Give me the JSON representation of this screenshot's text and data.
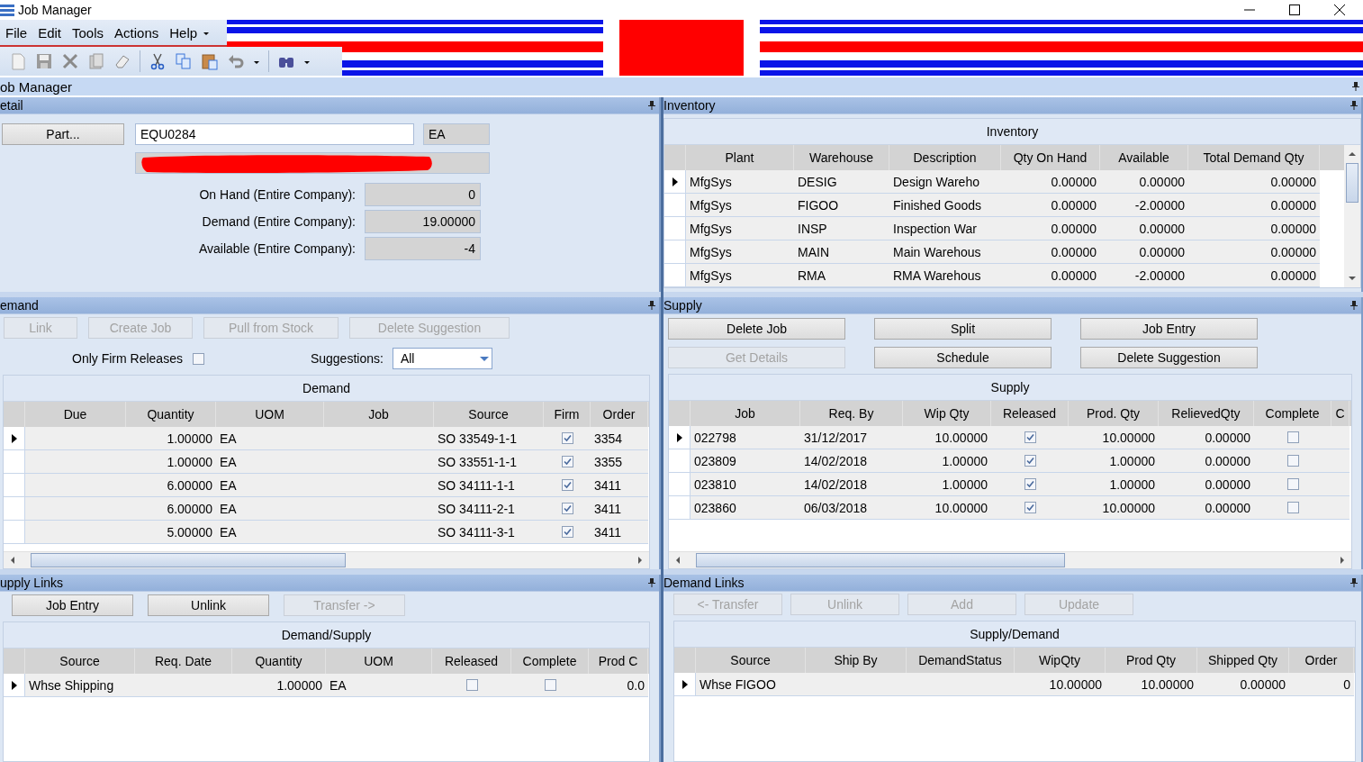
{
  "window": {
    "title": "Job Manager"
  },
  "menu": [
    "File",
    "Edit",
    "Tools",
    "Actions",
    "Help"
  ],
  "workspace": {
    "title": "ob Manager"
  },
  "detail": {
    "title": "etail",
    "part_button": "Part...",
    "part_number": "EQU0284",
    "uom": "EA",
    "description_redacted": true,
    "totals": [
      {
        "label": "On Hand (Entire Company):",
        "value": "0"
      },
      {
        "label": "Demand (Entire Company):",
        "value": "19.00000"
      },
      {
        "label": "Available (Entire Company):",
        "value": "-4"
      }
    ]
  },
  "inventory": {
    "title": "Inventory",
    "grid": {
      "caption": "Inventory",
      "columns": [
        {
          "label": "Plant",
          "kind": "text"
        },
        {
          "label": "Warehouse",
          "kind": "text"
        },
        {
          "label": "Description",
          "kind": "text"
        },
        {
          "label": "Qty On Hand",
          "kind": "number"
        },
        {
          "label": "Available",
          "kind": "number"
        },
        {
          "label": "Total Demand Qty",
          "kind": "number"
        }
      ],
      "rows": [
        {
          "selected": true,
          "cells": [
            "MfgSys",
            "DESIG",
            "Design Wareho",
            "0.00000",
            "0.00000",
            "0.00000"
          ]
        },
        {
          "selected": false,
          "cells": [
            "MfgSys",
            "FIGOO",
            "Finished Goods",
            "0.00000",
            "-2.00000",
            "0.00000"
          ]
        },
        {
          "selected": false,
          "cells": [
            "MfgSys",
            "INSP",
            "Inspection War",
            "0.00000",
            "0.00000",
            "0.00000"
          ]
        },
        {
          "selected": false,
          "cells": [
            "MfgSys",
            "MAIN",
            "Main Warehous",
            "0.00000",
            "0.00000",
            "0.00000"
          ]
        },
        {
          "selected": false,
          "cells": [
            "MfgSys",
            "RMA",
            "RMA Warehous",
            "0.00000",
            "-2.00000",
            "0.00000"
          ]
        }
      ]
    }
  },
  "demand": {
    "title": "emand",
    "buttons": [
      {
        "label": "Link",
        "disabled": true
      },
      {
        "label": "Create Job",
        "disabled": true
      },
      {
        "label": "Pull from Stock",
        "disabled": true
      },
      {
        "label": "Delete Suggestion",
        "disabled": true
      }
    ],
    "only_firm_releases": {
      "label": "Only Firm Releases",
      "checked": false
    },
    "suggestions": {
      "label": "Suggestions:",
      "value": "All"
    },
    "grid": {
      "caption": "Demand",
      "columns": [
        {
          "label": "Due",
          "kind": "text"
        },
        {
          "label": "Quantity",
          "kind": "number"
        },
        {
          "label": "UOM",
          "kind": "text"
        },
        {
          "label": "Job",
          "kind": "text"
        },
        {
          "label": "Source",
          "kind": "text"
        },
        {
          "label": "Firm",
          "kind": "check"
        },
        {
          "label": "Order",
          "kind": "text"
        }
      ],
      "rows": [
        {
          "selected": true,
          "cells": [
            null,
            "1.00000",
            "EA",
            null,
            "SO 33549-1-1",
            true,
            "3354"
          ]
        },
        {
          "selected": false,
          "cells": [
            null,
            "1.00000",
            "EA",
            null,
            "SO 33551-1-1",
            true,
            "3355"
          ]
        },
        {
          "selected": false,
          "cells": [
            null,
            "6.00000",
            "EA",
            null,
            "SO 34111-1-1",
            true,
            "3411"
          ]
        },
        {
          "selected": false,
          "cells": [
            null,
            "6.00000",
            "EA",
            null,
            "SO 34111-2-1",
            true,
            "3411"
          ]
        },
        {
          "selected": false,
          "cells": [
            null,
            "5.00000",
            "EA",
            null,
            "SO 34111-3-1",
            true,
            "3411"
          ]
        }
      ]
    }
  },
  "supply": {
    "title": "Supply",
    "buttons": [
      {
        "label": "Delete Job",
        "disabled": false
      },
      {
        "label": "Split",
        "disabled": false
      },
      {
        "label": "Job Entry",
        "disabled": false
      },
      {
        "label": "Get Details",
        "disabled": true
      },
      {
        "label": "Schedule",
        "disabled": false
      },
      {
        "label": "Delete Suggestion",
        "disabled": false
      }
    ],
    "grid": {
      "caption": "Supply",
      "columns": [
        {
          "label": "Job",
          "kind": "text"
        },
        {
          "label": "Req. By",
          "kind": "text"
        },
        {
          "label": "Wip Qty",
          "kind": "number"
        },
        {
          "label": "Released",
          "kind": "check"
        },
        {
          "label": "Prod. Qty",
          "kind": "number"
        },
        {
          "label": "RelievedQty",
          "kind": "number"
        },
        {
          "label": "Complete",
          "kind": "check"
        },
        {
          "label": "C",
          "kind": "text"
        }
      ],
      "rows": [
        {
          "selected": true,
          "cells": [
            "022798",
            "31/12/2017",
            "10.00000",
            true,
            "10.00000",
            "0.00000",
            false,
            null
          ]
        },
        {
          "selected": false,
          "cells": [
            "023809",
            "14/02/2018",
            "1.00000",
            true,
            "1.00000",
            "0.00000",
            false,
            null
          ]
        },
        {
          "selected": false,
          "cells": [
            "023810",
            "14/02/2018",
            "1.00000",
            true,
            "1.00000",
            "0.00000",
            false,
            null
          ]
        },
        {
          "selected": false,
          "cells": [
            "023860",
            "06/03/2018",
            "10.00000",
            true,
            "10.00000",
            "0.00000",
            false,
            null
          ]
        }
      ]
    }
  },
  "supply_links": {
    "title": "upply Links",
    "buttons": [
      {
        "label": "Job Entry",
        "disabled": false
      },
      {
        "label": "Unlink",
        "disabled": false
      },
      {
        "label": "Transfer ->",
        "disabled": true
      }
    ],
    "grid": {
      "caption": "Demand/Supply",
      "columns": [
        {
          "label": "Source",
          "kind": "text"
        },
        {
          "label": "Req. Date",
          "kind": "text"
        },
        {
          "label": "Quantity",
          "kind": "number"
        },
        {
          "label": "UOM",
          "kind": "text"
        },
        {
          "label": "Released",
          "kind": "check"
        },
        {
          "label": "Complete",
          "kind": "check"
        },
        {
          "label": "Prod C",
          "kind": "number"
        }
      ],
      "rows": [
        {
          "selected": true,
          "cells": [
            "Whse Shipping",
            null,
            "1.00000",
            "EA",
            false,
            false,
            "0.0"
          ]
        }
      ]
    }
  },
  "demand_links": {
    "title": "Demand Links",
    "buttons": [
      {
        "label": "<- Transfer",
        "disabled": true
      },
      {
        "label": "Unlink",
        "disabled": true
      },
      {
        "label": "Add",
        "disabled": true
      },
      {
        "label": "Update",
        "disabled": true
      }
    ],
    "grid": {
      "caption": "Supply/Demand",
      "columns": [
        {
          "label": "Source",
          "kind": "text"
        },
        {
          "label": "Ship By",
          "kind": "text"
        },
        {
          "label": "DemandStatus",
          "kind": "text"
        },
        {
          "label": "WipQty",
          "kind": "number"
        },
        {
          "label": "Prod Qty",
          "kind": "number"
        },
        {
          "label": "Shipped Qty",
          "kind": "number"
        },
        {
          "label": "Order",
          "kind": "number"
        }
      ],
      "rows": [
        {
          "selected": true,
          "cells": [
            "Whse FIGOO",
            null,
            null,
            "10.00000",
            "10.00000",
            "0.00000",
            "0"
          ]
        }
      ]
    }
  }
}
